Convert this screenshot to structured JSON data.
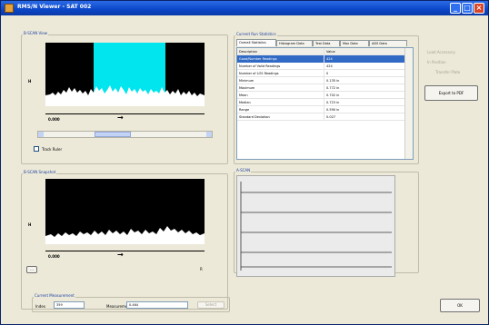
{
  "window": {
    "title": "RMS/N Viewer - SAT 002",
    "controls": [
      "minimize-icon",
      "maximize-icon",
      "close-icon"
    ]
  },
  "view_panel": {
    "label": "B-SCAN View",
    "y_label": "H",
    "x_value": "0.000",
    "arrow": "→",
    "checkbox_label": "Track Ruler",
    "checked": true
  },
  "snapshot_panel": {
    "label": "B-SCAN Snapshot",
    "y_label": "H",
    "x_value": "0.000",
    "arrow": "→",
    "small_button": "...",
    "marker": "R"
  },
  "current_measurement": {
    "label": "Current Measurement",
    "index_label": "Index",
    "index_value": "359",
    "measurement_label": "Measurement",
    "measurement_value": "0.464",
    "button": "Select"
  },
  "stats_panel": {
    "label": "Current Run Statistics",
    "tabs": [
      "Overall Statistics",
      "Histogram Data",
      "Test Data",
      "Max Data",
      "ADS Data"
    ],
    "columns": [
      "Description",
      "Value"
    ],
    "rows": [
      {
        "description": "Good/Number Readings",
        "value": "424"
      },
      {
        "description": "Number of Valid Readings",
        "value": "424"
      },
      {
        "description": "Number of LOS Readings",
        "value": "0"
      },
      {
        "description": "Minimum",
        "value": "0.135 in"
      },
      {
        "description": "Maximum",
        "value": "0.772 in"
      },
      {
        "description": "Mean",
        "value": "0.702 in"
      },
      {
        "description": "Median",
        "value": "0.723 in"
      },
      {
        "description": "Range",
        "value": "0.590 in"
      },
      {
        "description": "Standard Deviation",
        "value": "0.027"
      }
    ]
  },
  "side_options": {
    "load_accessory": "Load Accessory",
    "in_position": "In Position",
    "transfer_plate": "Transfer Plate",
    "button": "Export to PDF"
  },
  "waveform_panel": {
    "label": "A-SCAN"
  },
  "footer": {
    "ok_button": "OK"
  },
  "colors": {
    "highlight": "#00e5ee",
    "titlebar": "#0a46c8",
    "selection": "#316ac5"
  }
}
